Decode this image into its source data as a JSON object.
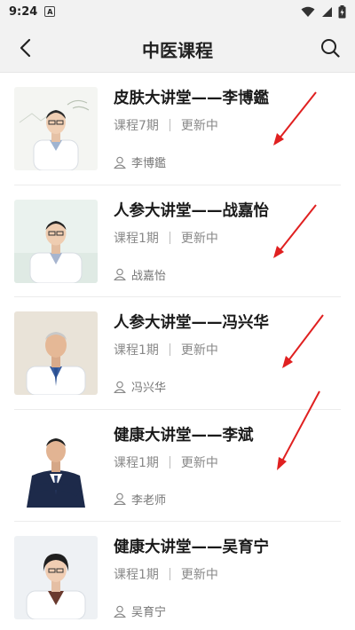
{
  "status_bar": {
    "time": "9:24",
    "notification_letter": "A",
    "icons": [
      "wifi-icon",
      "signal-icon",
      "battery-charging-icon"
    ]
  },
  "header": {
    "title": "中医课程",
    "back_icon": "chevron-left-icon",
    "search_icon": "search-icon"
  },
  "courses": [
    {
      "title": "皮肤大讲堂——李博鑑",
      "episodes": "课程7期",
      "status": "更新中",
      "author": "李博鑑"
    },
    {
      "title": "人参大讲堂——战嘉怡",
      "episodes": "课程1期",
      "status": "更新中",
      "author": "战嘉怡"
    },
    {
      "title": "人参大讲堂——冯兴华",
      "episodes": "课程1期",
      "status": "更新中",
      "author": "冯兴华"
    },
    {
      "title": "健康大讲堂——李斌",
      "episodes": "课程1期",
      "status": "更新中",
      "author": "李老师"
    },
    {
      "title": "健康大讲堂——吴育宁",
      "episodes": "课程1期",
      "status": "更新中",
      "author": "吴育宁"
    }
  ],
  "colors": {
    "app_bar_bg": "#f2f2f2",
    "annotation_arrow": "#e02020",
    "meta_text": "#888888"
  }
}
